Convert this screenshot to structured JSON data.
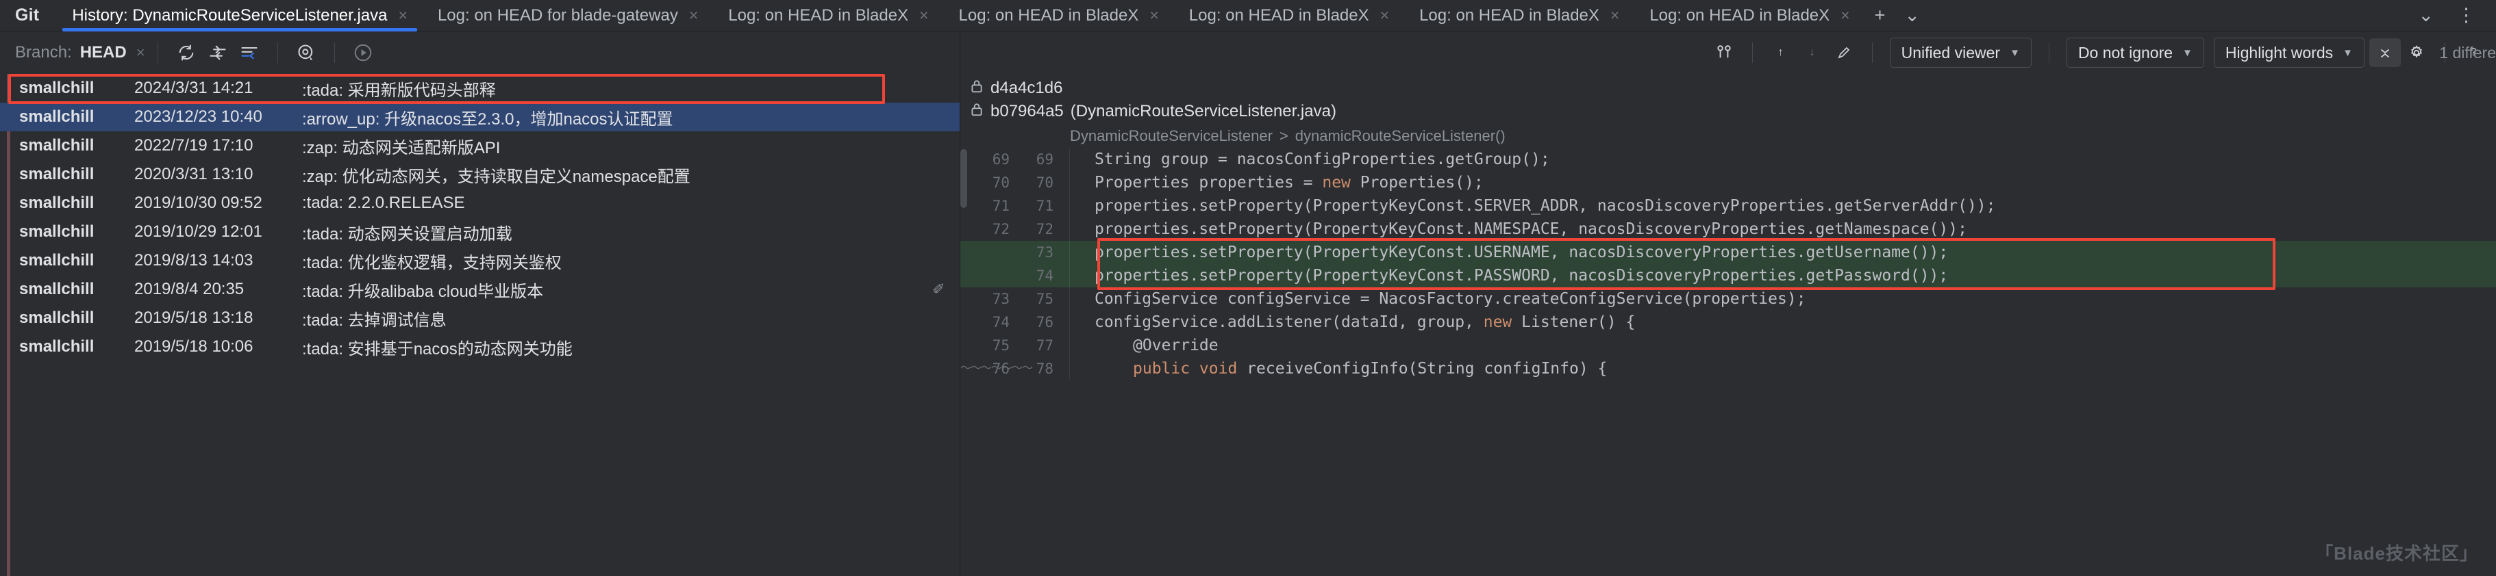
{
  "window": {
    "tool_window_title": "Git"
  },
  "tabs": [
    {
      "label": "History: DynamicRouteServiceListener.java",
      "active": true,
      "close": "×"
    },
    {
      "label": "Log: on HEAD for blade-gateway",
      "active": false,
      "close": "×"
    },
    {
      "label": "Log: on HEAD in BladeX",
      "active": false,
      "close": "×"
    },
    {
      "label": "Log: on HEAD in BladeX",
      "active": false,
      "close": "×"
    },
    {
      "label": "Log: on HEAD in BladeX",
      "active": false,
      "close": "×"
    },
    {
      "label": "Log: on HEAD in BladeX",
      "active": false,
      "close": "×"
    },
    {
      "label": "Log: on HEAD in BladeX",
      "active": false,
      "close": "×"
    }
  ],
  "tabbar_controls": {
    "add": "+",
    "list_dropdown": "⌄",
    "minimize": "⌄",
    "options": "⋮"
  },
  "branch_bar": {
    "label": "Branch:",
    "value": "HEAD",
    "clear": "×",
    "icons": [
      {
        "name": "refresh-icon"
      },
      {
        "name": "show-diff-icon"
      },
      {
        "name": "filter-icon"
      },
      {
        "name": "show-details-icon"
      },
      {
        "name": "run-icon"
      }
    ]
  },
  "commits": {
    "columns": [
      "Author",
      "Date",
      "Subject"
    ],
    "rows": [
      {
        "author": "smallchill",
        "date": "2024/3/31 14:21",
        "subject": ":tada: 采用新版代码头部释",
        "badge": "",
        "selected": false
      },
      {
        "author": "smallchill",
        "date": "2023/12/23 10:40",
        "subject": ":arrow_up: 升级nacos至2.3.0，增加nacos认证配置",
        "badge": "",
        "selected": true
      },
      {
        "author": "smallchill",
        "date": "2022/7/19 17:10",
        "subject": ":zap: 动态网关适配新版API",
        "badge": "",
        "selected": false
      },
      {
        "author": "smallchill",
        "date": "2020/3/31 13:10",
        "subject": ":zap: 优化动态网关，支持读取自定义namespace配置",
        "badge": "",
        "selected": false
      },
      {
        "author": "smallchill",
        "date": "2019/10/30 09:52",
        "subject": ":tada: 2.2.0.RELEASE",
        "badge": "",
        "selected": false
      },
      {
        "author": "smallchill",
        "date": "2019/10/29 12:01",
        "subject": ":tada: 动态网关设置启动加载",
        "badge": "",
        "selected": false
      },
      {
        "author": "smallchill",
        "date": "2019/8/13 14:03",
        "subject": ":tada: 优化鉴权逻辑，支持网关鉴权",
        "badge": "",
        "selected": false
      },
      {
        "author": "smallchill",
        "date": "2019/8/4 20:35",
        "subject": ":tada: 升级alibaba cloud毕业版本",
        "badge": "✐",
        "selected": false
      },
      {
        "author": "smallchill",
        "date": "2019/5/18 13:18",
        "subject": ":tada: 去掉调试信息",
        "badge": "",
        "selected": false
      },
      {
        "author": "smallchill",
        "date": "2019/5/18 10:06",
        "subject": ":tada: 安排基于nacos的动态网关功能",
        "badge": "",
        "selected": false
      }
    ]
  },
  "diff_toolbar": {
    "compare_icon": "compare-branches-icon",
    "prev_difference": "↑",
    "next_difference": "↓",
    "editor_settings": "✐",
    "viewer_mode": "Unified viewer",
    "whitespace_mode": "Do not ignore",
    "highlight_mode": "Highlight words",
    "collapse": "⌄",
    "settings": "⚙",
    "help": "?",
    "difference_count": "1 differe"
  },
  "revisions": [
    {
      "lock": "🔒",
      "hash": "d4a4c1d6",
      "file": ""
    },
    {
      "lock": "🔒",
      "hash": "b07964a5",
      "file": "(DynamicRouteServiceListener.java)"
    }
  ],
  "breadcrumb": {
    "class": "DynamicRouteServiceListener",
    "separator": ">",
    "method": "dynamicRouteServiceListener()"
  },
  "code": {
    "lines": [
      {
        "old": "69",
        "new": "69",
        "indent": 0,
        "text": "String group = nacosConfigProperties.getGroup();",
        "state": "context"
      },
      {
        "old": "70",
        "new": "70",
        "indent": 0,
        "text": "Properties properties = new Properties();",
        "state": "context",
        "kw": "new"
      },
      {
        "old": "71",
        "new": "71",
        "indent": 0,
        "text": "properties.setProperty(PropertyKeyConst.SERVER_ADDR, nacosDiscoveryProperties.getServerAddr());",
        "state": "context"
      },
      {
        "old": "72",
        "new": "72",
        "indent": 0,
        "text": "properties.setProperty(PropertyKeyConst.NAMESPACE, nacosDiscoveryProperties.getNamespace());",
        "state": "context"
      },
      {
        "old": "",
        "new": "73",
        "indent": 0,
        "text": "properties.setProperty(PropertyKeyConst.USERNAME, nacosDiscoveryProperties.getUsername());",
        "state": "added"
      },
      {
        "old": "",
        "new": "74",
        "indent": 0,
        "text": "properties.setProperty(PropertyKeyConst.PASSWORD, nacosDiscoveryProperties.getPassword());",
        "state": "added"
      },
      {
        "old": "73",
        "new": "75",
        "indent": 0,
        "text": "ConfigService configService = NacosFactory.createConfigService(properties);",
        "state": "context"
      },
      {
        "old": "74",
        "new": "76",
        "indent": 0,
        "text": "configService.addListener(dataId, group, new Listener() {",
        "state": "context",
        "kw": "new"
      },
      {
        "old": "75",
        "new": "77",
        "indent": 1,
        "text": "@Override",
        "state": "context"
      },
      {
        "old": "76",
        "new": "78",
        "indent": 1,
        "text": "public void receiveConfigInfo(String configInfo) {",
        "state": "context",
        "kw": "public void"
      }
    ]
  },
  "watermark": {
    "open_bracket": "「",
    "text": "Blade技术社区",
    "close_bracket": "」"
  },
  "colors": {
    "accent": "#3574f0",
    "selection": "#2f4673",
    "added_bg": "#2e4535",
    "annotation": "#f04438",
    "background": "#2b2d30",
    "text": "#dfe1e5"
  }
}
